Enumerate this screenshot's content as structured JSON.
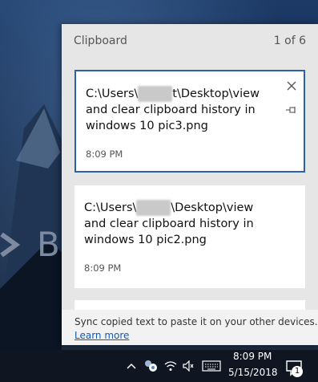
{
  "clipboard": {
    "title": "Clipboard",
    "count": "1 of 6",
    "items": [
      {
        "path_prefix": "C:\\Users\\",
        "redacted": "xxxxx",
        "path_rest": "t\\Desktop\\view and clear clipboard history in windows 10 pic3.png",
        "time": "8:09 PM",
        "selected": true
      },
      {
        "path_prefix": "C:\\Users\\",
        "redacted": "xxxxx",
        "path_rest": "\\Desktop\\view and clear clipboard history in windows 10 pic2.png",
        "time": "8:09 PM",
        "selected": false
      }
    ],
    "sync_text": "Sync copied text to paste it on your other devices.",
    "learn_more": "Learn more"
  },
  "taskbar": {
    "time": "8:09 PM",
    "date": "5/15/2018",
    "notification_count": "1"
  },
  "colors": {
    "accent": "#2a62a8",
    "link": "#0f5bbd",
    "panel_bg": "#e6e6e6",
    "taskbar_bg": "#0f1622"
  },
  "icons": [
    "close-icon",
    "pin-icon",
    "chevron-up-icon",
    "network-people-icon",
    "wifi-icon",
    "keyboard-icon",
    "notification-icon"
  ]
}
